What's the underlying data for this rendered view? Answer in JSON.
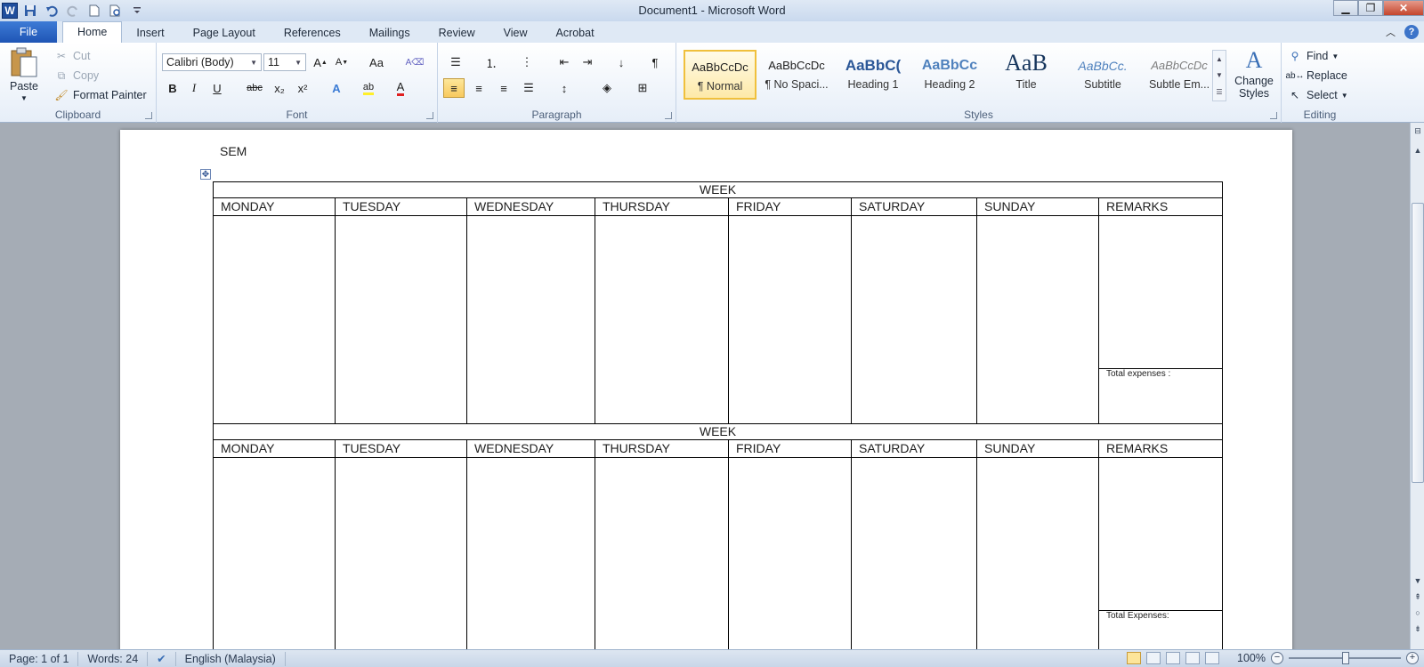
{
  "window": {
    "title": "Document1  -  Microsoft Word",
    "app_icon": "W",
    "controls": {
      "minimize": "▁",
      "maximize": "❐",
      "close": "✕"
    }
  },
  "quick_access": [
    "save-icon",
    "undo-icon",
    "redo-icon",
    "new-document-icon",
    "print-preview-icon",
    "customize-icon"
  ],
  "tabs": [
    {
      "label": "File"
    },
    {
      "label": "Home"
    },
    {
      "label": "Insert"
    },
    {
      "label": "Page Layout"
    },
    {
      "label": "References"
    },
    {
      "label": "Mailings"
    },
    {
      "label": "Review"
    },
    {
      "label": "View"
    },
    {
      "label": "Acrobat"
    }
  ],
  "ribbon": {
    "clipboard": {
      "label": "Clipboard",
      "paste": "Paste",
      "cut": "Cut",
      "copy": "Copy",
      "format_painter": "Format Painter"
    },
    "font": {
      "label": "Font",
      "font_name": "Calibri (Body)",
      "font_size": "11",
      "bold": "B",
      "italic": "I",
      "underline": "U",
      "strikethrough": "abc",
      "subscript": "x₂",
      "superscript": "x²",
      "change_case": "Aa"
    },
    "paragraph": {
      "label": "Paragraph",
      "show_marks": "¶"
    },
    "styles": {
      "label": "Styles",
      "items": [
        {
          "sample": "AaBbCcDc",
          "name": "¶ Normal"
        },
        {
          "sample": "AaBbCcDc",
          "name": "¶ No Spaci..."
        },
        {
          "sample": "AaBbC(",
          "name": "Heading 1"
        },
        {
          "sample": "AaBbCc",
          "name": "Heading 2"
        },
        {
          "sample": "AaB",
          "name": "Title"
        },
        {
          "sample": "AaBbCc.",
          "name": "Subtitle"
        },
        {
          "sample": "AaBbCcDc",
          "name": "Subtle Em..."
        }
      ],
      "change_styles": "Change Styles"
    },
    "editing": {
      "label": "Editing",
      "find": "Find",
      "replace": "Replace",
      "select": "Select"
    }
  },
  "document": {
    "heading": "SEM",
    "week_label": "WEEK",
    "days": [
      "MONDAY",
      "TUESDAY",
      "WEDNESDAY",
      "THURSDAY",
      "FRIDAY",
      "SATURDAY",
      "SUNDAY",
      "REMARKS"
    ],
    "total_1": "Total expenses :",
    "total_2": "Total Expenses:"
  },
  "status": {
    "page": "Page: 1 of 1",
    "words": "Words: 24",
    "language": "English (Malaysia)",
    "zoom": "100%"
  }
}
